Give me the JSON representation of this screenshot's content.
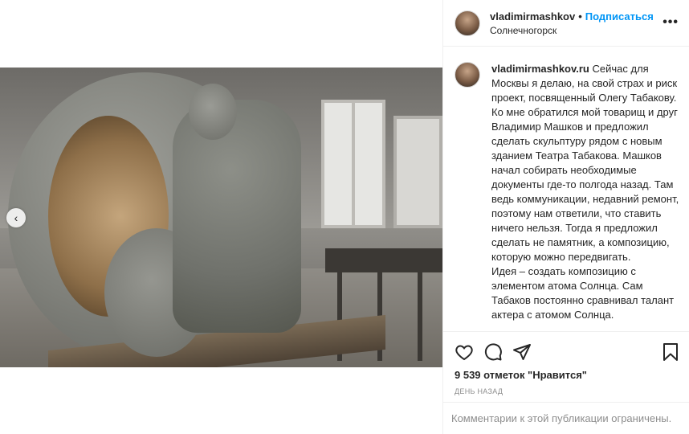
{
  "post": {
    "author": "vladimirmashkov",
    "follow_label": "Подписаться",
    "separator": "•",
    "location": "Солнечногорск",
    "more_label": "•••"
  },
  "caption": {
    "author": "vladimirmashkov.ru",
    "text": " Сейчас для Москвы я делаю, на свой страх и риск проект, посвященный Олегу Табакову. Ко мне обратился мой товарищ и друг Владимир Машков и предложил сделать скульптуру рядом с новым зданием Театра Табакова. Машков начал собирать необходимые документы где-то полгода назад. Там ведь коммуникации, недавний ремонт, поэтому нам ответили, что ставить ничего нельзя. Тогда я предложил сделать не памятник, а композицию, которую можно передвигать.\nИдея – создать композицию с элементом атома Солнца. Сам Табаков постоянно сравнивал талант актера с атомом Солнца."
  },
  "actions": {
    "likes": "9 539 отметок \"Нравится\"",
    "timestamp": "ДЕНЬ НАЗАД"
  },
  "comments_notice": "Комментарии к этой публикации ограничены.",
  "media": {
    "nav_prev_label": "‹"
  },
  "icons": {
    "like": "heart-icon",
    "comment": "comment-icon",
    "share": "share-icon",
    "save": "bookmark-icon",
    "more": "more-icon",
    "prev": "chevron-left-icon"
  },
  "colors": {
    "link": "#0095f6",
    "text": "#262626",
    "muted": "#8e8e8e",
    "border": "#efefef"
  }
}
